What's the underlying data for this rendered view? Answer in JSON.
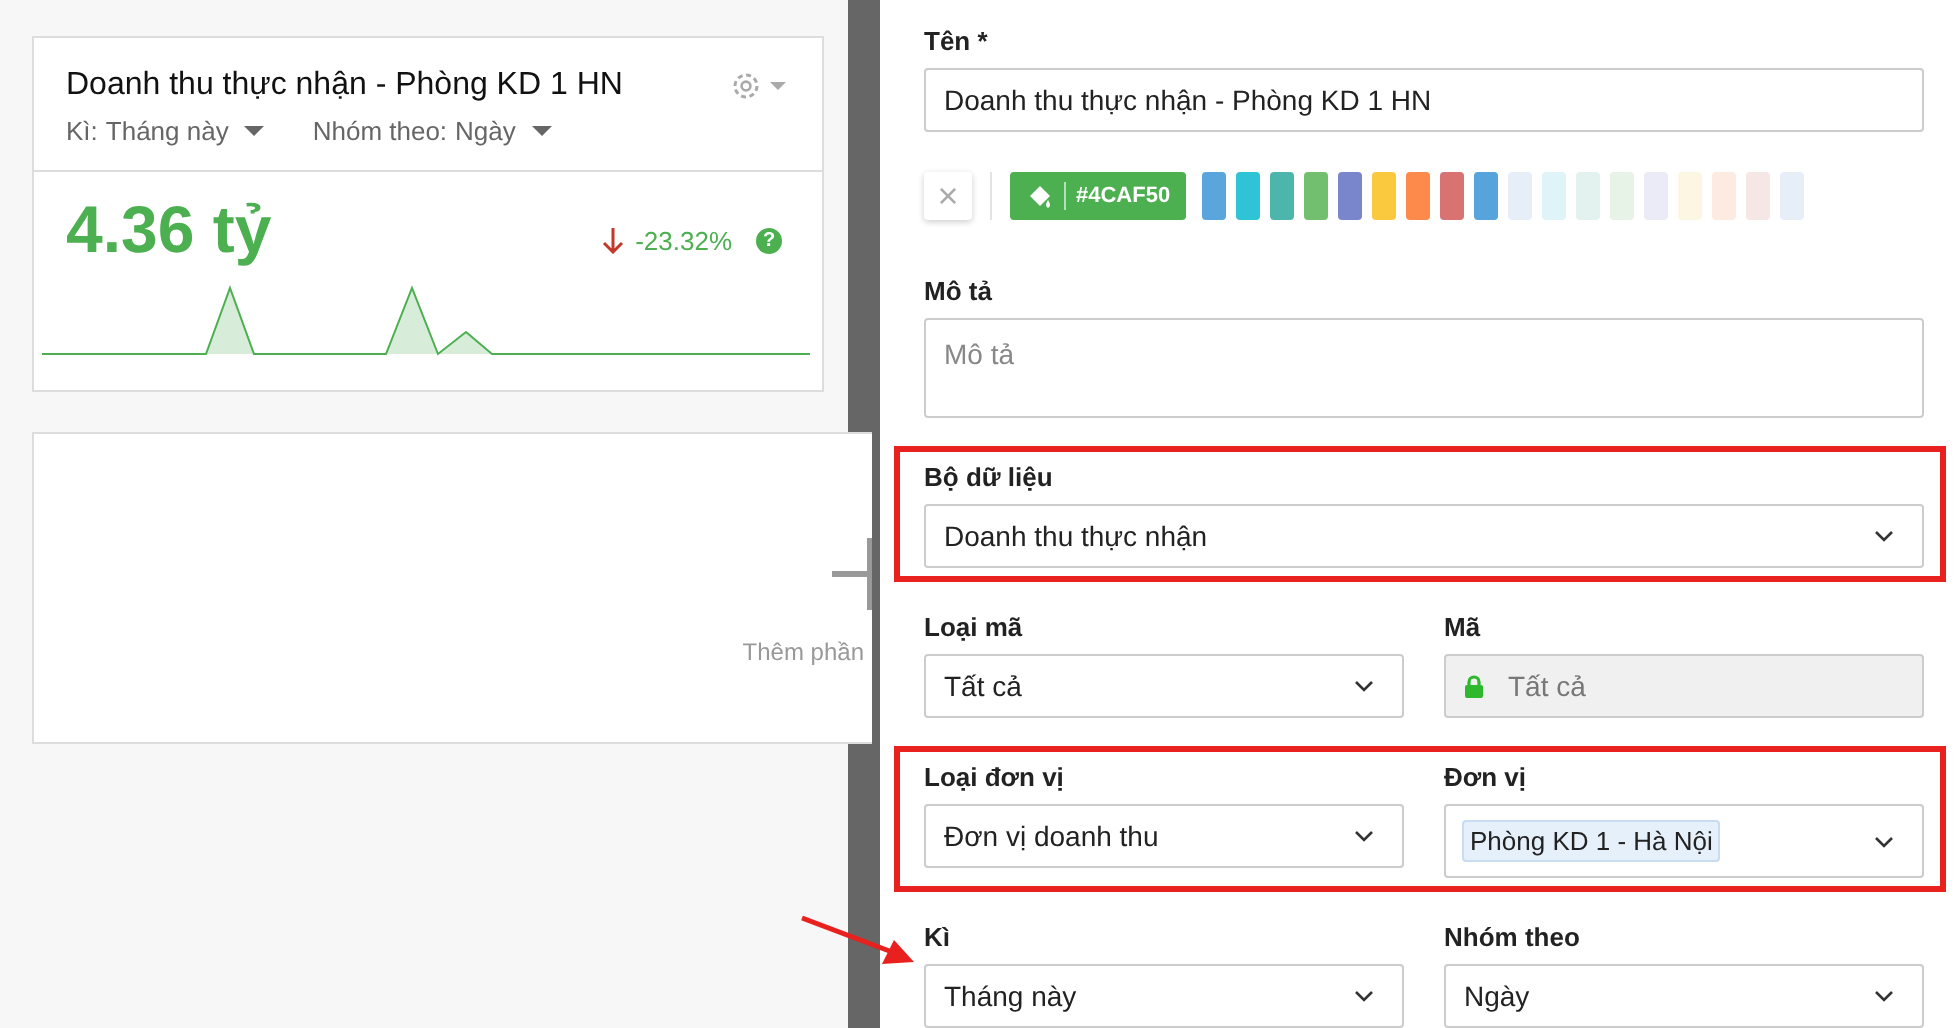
{
  "widget_card": {
    "title": "Doanh thu thực nhận - Phòng KD 1 HN",
    "filters": [
      {
        "label": "Kì:",
        "value": "Tháng này"
      },
      {
        "label": "Nhóm theo:",
        "value": "Ngày"
      }
    ],
    "value": "4.36 tỷ",
    "falling": true,
    "change": "-23.32%",
    "help": "?"
  },
  "add_card": {
    "label": "Thêm phần"
  },
  "form": {
    "name_field": {
      "label": "Tên *",
      "value": "Doanh thu thực nhận - Phòng KD 1 HN"
    },
    "color_picker": {
      "clear": "×",
      "current": {
        "label": "#4CAF50",
        "color": "#4caf50"
      },
      "swatches": [
        {
          "color": "#5aa5dc"
        },
        {
          "color": "#2ec4d6"
        },
        {
          "color": "#4db6ac"
        },
        {
          "color": "#72bf6f"
        },
        {
          "color": "#7986cb"
        },
        {
          "color": "#fbc93d"
        },
        {
          "color": "#fd8a4b"
        },
        {
          "color": "#d97371"
        },
        {
          "color": "#57a3dc"
        },
        {
          "color": "#e6eef8"
        },
        {
          "color": "#dff4f8"
        },
        {
          "color": "#e3f2ef"
        },
        {
          "color": "#e8f3e8"
        },
        {
          "color": "#eaebf6"
        },
        {
          "color": "#fdf6e3"
        },
        {
          "color": "#fdebe2"
        },
        {
          "color": "#f7e6e6"
        },
        {
          "color": "#e6eef7"
        }
      ]
    },
    "description": {
      "label": "Mô tả",
      "placeholder": "Mô tả"
    },
    "rows": [
      {
        "highlighted": true,
        "fields": [
          {
            "kind": "select",
            "label": "Bộ dữ liệu",
            "value": "Doanh thu thực nhận"
          }
        ]
      },
      {
        "highlighted": false,
        "fields": [
          {
            "kind": "select",
            "label": "Loại mã",
            "value": "Tất cả"
          },
          {
            "kind": "locked",
            "label": "Mã",
            "value": "Tất cả"
          }
        ]
      },
      {
        "highlighted": true,
        "fields": [
          {
            "kind": "select",
            "label": "Loại đơn vị",
            "value": "Đơn vị doanh thu"
          },
          {
            "kind": "tags",
            "label": "Đơn vị",
            "value": "Phòng KD 1 - Hà Nội"
          }
        ]
      },
      {
        "highlighted": false,
        "fields": [
          {
            "kind": "select",
            "label": "Kì",
            "value": "Tháng này"
          },
          {
            "kind": "select",
            "label": "Nhóm theo",
            "value": "Ngày"
          }
        ]
      }
    ]
  },
  "pointer_arrow": true
}
